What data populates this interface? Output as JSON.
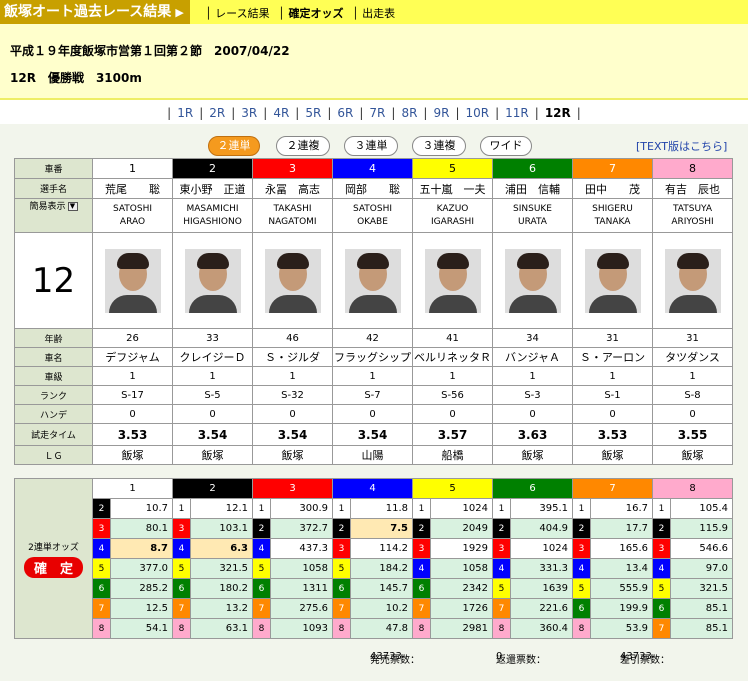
{
  "topnav": {
    "site_title": "飯塚オート過去レース結果",
    "links": [
      "レース結果",
      "確定オッズ",
      "出走表"
    ]
  },
  "header": {
    "title_line": "平成１９年度飯塚市営第１回第２節　2007/04/22",
    "race_line": "12R　優勝戦　3100m"
  },
  "race_nav": [
    "1R",
    "2R",
    "3R",
    "4R",
    "5R",
    "6R",
    "7R",
    "8R",
    "9R",
    "10R",
    "11R",
    "12R"
  ],
  "current_race": "12R",
  "odds_tabs": [
    "２連単",
    "２連複",
    "３連単",
    "３連複",
    "ワイド"
  ],
  "text_link": "[TEXT版はこちら]",
  "race_number_display": "12",
  "row_labels": {
    "car_no": "車番",
    "rider": "選手名",
    "simple_view": "簡易表示",
    "age": "年齢",
    "bike": "車名",
    "class": "車級",
    "rank": "ランク",
    "handicap": "ハンデ",
    "trial_time": "試走タイム",
    "lg": "ＬＧ"
  },
  "riders": [
    {
      "no": "1",
      "name": "荒尾　　聡",
      "romaji1": "SATOSHI",
      "romaji2": "ARAO",
      "age": "26",
      "bike": "デフジャム",
      "class": "1",
      "rank": "S-17",
      "handicap": "0",
      "trial": "3.53",
      "lg": "飯塚"
    },
    {
      "no": "2",
      "name": "東小野　正道",
      "romaji1": "MASAMICHI",
      "romaji2": "HIGASHIONO",
      "age": "33",
      "bike": "クレイジーＤ",
      "class": "1",
      "rank": "S-5",
      "handicap": "0",
      "trial": "3.54",
      "lg": "飯塚"
    },
    {
      "no": "3",
      "name": "永冨　高志",
      "romaji1": "TAKASHI",
      "romaji2": "NAGATOMI",
      "age": "46",
      "bike": "Ｓ・ジルダ",
      "class": "1",
      "rank": "S-32",
      "handicap": "0",
      "trial": "3.54",
      "lg": "飯塚"
    },
    {
      "no": "4",
      "name": "岡部　　聡",
      "romaji1": "SATOSHI",
      "romaji2": "OKABE",
      "age": "42",
      "bike": "フラッグシップ",
      "class": "1",
      "rank": "S-7",
      "handicap": "0",
      "trial": "3.54",
      "lg": "山陽"
    },
    {
      "no": "5",
      "name": "五十嵐　一夫",
      "romaji1": "KAZUO",
      "romaji2": "IGARASHI",
      "age": "41",
      "bike": "ベルリネッタＲ",
      "class": "1",
      "rank": "S-56",
      "handicap": "0",
      "trial": "3.57",
      "lg": "船橋"
    },
    {
      "no": "6",
      "name": "浦田　信輔",
      "romaji1": "SINSUKE",
      "romaji2": "URATA",
      "age": "34",
      "bike": "バンジャＡ",
      "class": "1",
      "rank": "S-3",
      "handicap": "0",
      "trial": "3.63",
      "lg": "飯塚"
    },
    {
      "no": "7",
      "name": "田中　　茂",
      "romaji1": "SHIGERU",
      "romaji2": "TANAKA",
      "age": "31",
      "bike": "Ｓ・アーロン",
      "class": "1",
      "rank": "S-1",
      "handicap": "0",
      "trial": "3.53",
      "lg": "飯塚"
    },
    {
      "no": "8",
      "name": "有吉　辰也",
      "romaji1": "TATSUYA",
      "romaji2": "ARIYOSHI",
      "age": "31",
      "bike": "タツダンス",
      "class": "1",
      "rank": "S-8",
      "handicap": "0",
      "trial": "3.55",
      "lg": "飯塚"
    }
  ],
  "odds": {
    "side_label": "2連単オッズ",
    "status_badge": "確　定",
    "columns": [
      {
        "head": "1",
        "rows": [
          [
            "2",
            "10.7"
          ],
          [
            "3",
            "80.1"
          ],
          [
            "4",
            "8.7"
          ],
          [
            "5",
            "377.0"
          ],
          [
            "6",
            "285.2"
          ],
          [
            "7",
            "12.5"
          ],
          [
            "8",
            "54.1"
          ]
        ]
      },
      {
        "head": "2",
        "rows": [
          [
            "1",
            "12.1"
          ],
          [
            "3",
            "103.1"
          ],
          [
            "4",
            "6.3"
          ],
          [
            "5",
            "321.5"
          ],
          [
            "6",
            "180.2"
          ],
          [
            "7",
            "13.2"
          ],
          [
            "8",
            "63.1"
          ]
        ]
      },
      {
        "head": "3",
        "rows": [
          [
            "1",
            "300.9"
          ],
          [
            "2",
            "372.7"
          ],
          [
            "4",
            "437.3"
          ],
          [
            "5",
            "1058"
          ],
          [
            "6",
            "1311"
          ],
          [
            "7",
            "275.6"
          ],
          [
            "8",
            "1093"
          ]
        ]
      },
      {
        "head": "4",
        "rows": [
          [
            "1",
            "11.8"
          ],
          [
            "2",
            "7.5"
          ],
          [
            "3",
            "114.2"
          ],
          [
            "5",
            "184.2"
          ],
          [
            "6",
            "145.7"
          ],
          [
            "7",
            "10.2"
          ],
          [
            "8",
            "47.8"
          ]
        ]
      },
      {
        "head": "5",
        "rows": [
          [
            "1",
            "1024"
          ],
          [
            "2",
            "2049"
          ],
          [
            "3",
            "1929"
          ],
          [
            "4",
            "1058"
          ],
          [
            "6",
            "2342"
          ],
          [
            "7",
            "1726"
          ],
          [
            "8",
            "2981"
          ]
        ]
      },
      {
        "head": "6",
        "rows": [
          [
            "1",
            "395.1"
          ],
          [
            "2",
            "404.9"
          ],
          [
            "3",
            "1024"
          ],
          [
            "4",
            "331.3"
          ],
          [
            "5",
            "1639"
          ],
          [
            "7",
            "221.6"
          ],
          [
            "8",
            "360.4"
          ]
        ]
      },
      {
        "head": "7",
        "rows": [
          [
            "1",
            "16.7"
          ],
          [
            "2",
            "17.7"
          ],
          [
            "3",
            "165.6"
          ],
          [
            "4",
            "13.4"
          ],
          [
            "5",
            "555.9"
          ],
          [
            "6",
            "199.9"
          ],
          [
            "8",
            "53.9"
          ]
        ]
      },
      {
        "head": "8",
        "rows": [
          [
            "1",
            "105.4"
          ],
          [
            "2",
            "115.9"
          ],
          [
            "3",
            "546.6"
          ],
          [
            "4",
            "97.0"
          ],
          [
            "5",
            "321.5"
          ],
          [
            "6",
            "85.1"
          ],
          [
            "7",
            "85.1"
          ]
        ]
      }
    ]
  },
  "footer": {
    "sales_label": "発売票数：",
    "sales_value": "43733",
    "refund_label": "返還票数：",
    "refund_value": "0",
    "net_label": "差引票数：",
    "net_value": "43733"
  }
}
